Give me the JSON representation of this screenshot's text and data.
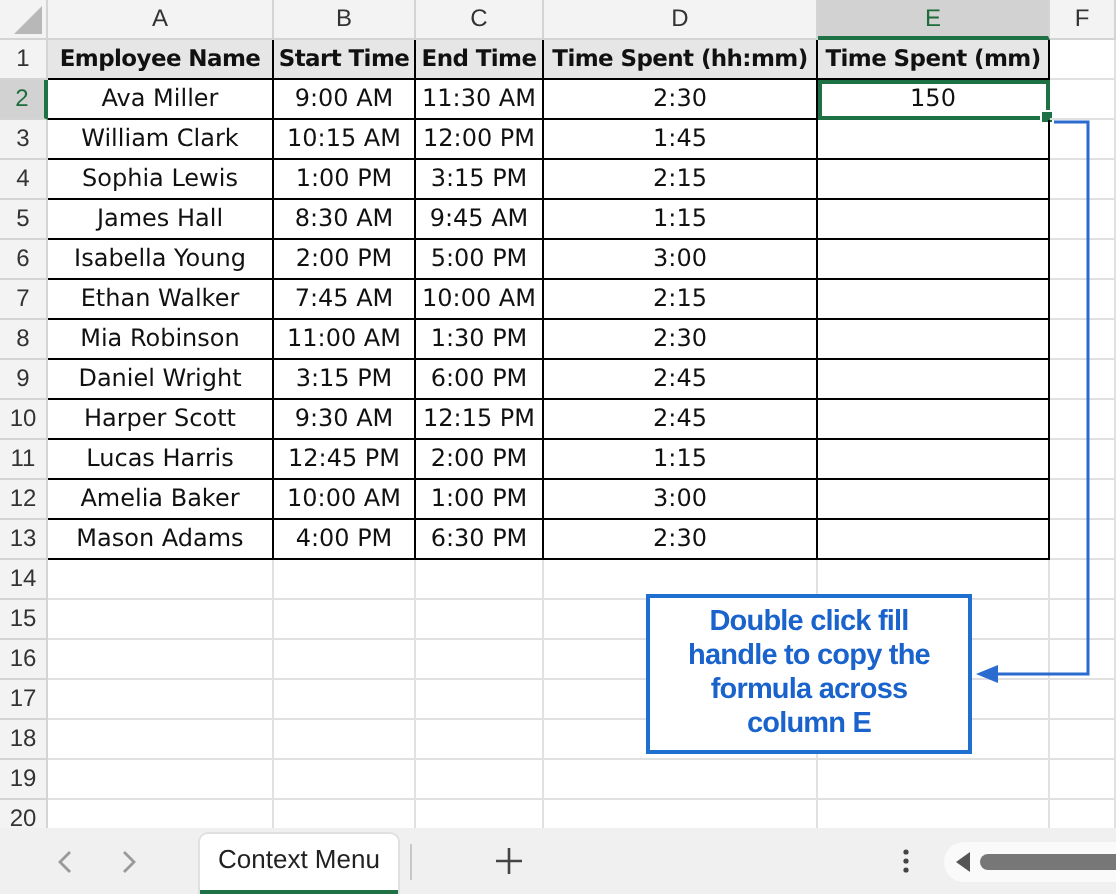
{
  "columns": [
    {
      "letter": "A",
      "selected": false
    },
    {
      "letter": "B",
      "selected": false
    },
    {
      "letter": "C",
      "selected": false
    },
    {
      "letter": "D",
      "selected": false
    },
    {
      "letter": "E",
      "selected": true
    },
    {
      "letter": "F",
      "selected": false
    }
  ],
  "rows": [
    {
      "number": "1",
      "selected": false,
      "kind": "header",
      "cells": [
        "Employee Name",
        "Start Time",
        "End Time",
        "Time Spent (hh:mm)",
        "Time Spent (mm)"
      ]
    },
    {
      "number": "2",
      "selected": true,
      "kind": "data",
      "cells": [
        "Ava Miller",
        "9:00 AM",
        "11:30 AM",
        "2:30",
        "150"
      ]
    },
    {
      "number": "3",
      "selected": false,
      "kind": "data",
      "cells": [
        "William Clark",
        "10:15 AM",
        "12:00 PM",
        "1:45"
      ]
    },
    {
      "number": "4",
      "selected": false,
      "kind": "data",
      "cells": [
        "Sophia Lewis",
        "1:00 PM",
        "3:15 PM",
        "2:15"
      ]
    },
    {
      "number": "5",
      "selected": false,
      "kind": "data",
      "cells": [
        "James Hall",
        "8:30 AM",
        "9:45 AM",
        "1:15"
      ]
    },
    {
      "number": "6",
      "selected": false,
      "kind": "data",
      "cells": [
        "Isabella Young",
        "2:00 PM",
        "5:00 PM",
        "3:00"
      ]
    },
    {
      "number": "7",
      "selected": false,
      "kind": "data",
      "cells": [
        "Ethan Walker",
        "7:45 AM",
        "10:00 AM",
        "2:15"
      ]
    },
    {
      "number": "8",
      "selected": false,
      "kind": "data",
      "cells": [
        "Mia Robinson",
        "11:00 AM",
        "1:30 PM",
        "2:30"
      ]
    },
    {
      "number": "9",
      "selected": false,
      "kind": "data",
      "cells": [
        "Daniel Wright",
        "3:15 PM",
        "6:00 PM",
        "2:45"
      ]
    },
    {
      "number": "10",
      "selected": false,
      "kind": "data",
      "cells": [
        "Harper Scott",
        "9:30 AM",
        "12:15 PM",
        "2:45"
      ]
    },
    {
      "number": "11",
      "selected": false,
      "kind": "data",
      "cells": [
        "Lucas Harris",
        "12:45 PM",
        "2:00 PM",
        "1:15"
      ]
    },
    {
      "number": "12",
      "selected": false,
      "kind": "data",
      "cells": [
        "Amelia Baker",
        "10:00 AM",
        "1:00 PM",
        "3:00"
      ]
    },
    {
      "number": "13",
      "selected": false,
      "kind": "data",
      "cells": [
        "Mason Adams",
        "4:00 PM",
        "6:30 PM",
        "2:30"
      ]
    },
    {
      "number": "14",
      "selected": false,
      "kind": "empty",
      "cells": []
    },
    {
      "number": "15",
      "selected": false,
      "kind": "empty",
      "cells": []
    },
    {
      "number": "16",
      "selected": false,
      "kind": "empty",
      "cells": []
    },
    {
      "number": "17",
      "selected": false,
      "kind": "empty",
      "cells": []
    },
    {
      "number": "18",
      "selected": false,
      "kind": "empty",
      "cells": []
    },
    {
      "number": "19",
      "selected": false,
      "kind": "empty",
      "cells": []
    },
    {
      "number": "20",
      "selected": false,
      "kind": "empty",
      "cells": []
    }
  ],
  "callout": {
    "text": "Double click fill handle to copy the formula across column E"
  },
  "sheet_tabs": [
    {
      "label": "Context Menu",
      "selected": true
    }
  ]
}
